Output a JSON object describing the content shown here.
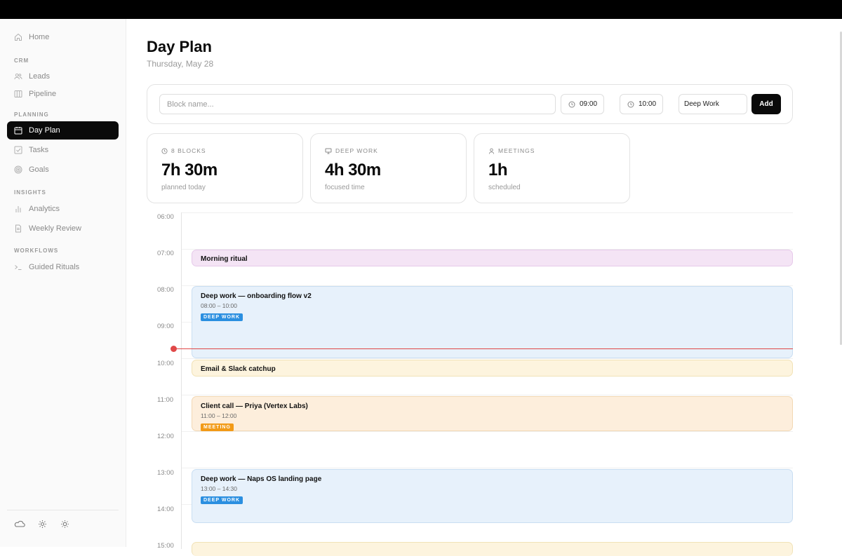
{
  "sidebar": {
    "home": "Home",
    "sections": {
      "crm": "CRM",
      "planning": "PLANNING",
      "insights": "INSIGHTS",
      "workflows": "WORKFLOWS"
    },
    "items": {
      "leads": "Leads",
      "pipeline": "Pipeline",
      "day_plan": "Day Plan",
      "tasks": "Tasks",
      "goals": "Goals",
      "analytics": "Analytics",
      "weekly_review": "Weekly Review",
      "guided_rituals": "Guided Rituals"
    },
    "active_item": "Day Plan",
    "footer_icons": [
      "cloud-icon",
      "settings-gear-icon",
      "sun-icon"
    ]
  },
  "header": {
    "title": "Day Plan",
    "date": "Thursday, May 28"
  },
  "add_bar": {
    "name_placeholder": "Block name...",
    "start_time": "09:00",
    "end_time": "10:00",
    "category": "Deep Work",
    "add_label": "Add"
  },
  "stats": [
    {
      "label": "8 BLOCKS",
      "value": "7h 30m",
      "sub": "planned today",
      "icon": "clock-icon"
    },
    {
      "label": "DEEP WORK",
      "value": "4h 30m",
      "sub": "focused time",
      "icon": "monitor-icon"
    },
    {
      "label": "MEETINGS",
      "value": "1h",
      "sub": "scheduled",
      "icon": "person-icon"
    }
  ],
  "timeline": {
    "hours": [
      "06:00",
      "07:00",
      "08:00",
      "09:00",
      "10:00",
      "11:00",
      "12:00",
      "13:00",
      "14:00",
      "15:00"
    ],
    "current_time_marker": "09:45",
    "blocks": [
      {
        "title": "Morning ritual",
        "time": "",
        "tag": "",
        "color": "#f3e3f5"
      },
      {
        "title": "Deep work — onboarding flow v2",
        "time": "08:00 – 10:00",
        "tag": "DEEP WORK",
        "color": "#e6f1fb"
      },
      {
        "title": "Email & Slack catchup",
        "time": "",
        "tag": "",
        "color": "#fdf4dd"
      },
      {
        "title": "Client call — Priya (Vertex Labs)",
        "time": "11:00 – 12:00",
        "tag": "MEETING",
        "color": "#fdeedb"
      },
      {
        "title": "Deep work — Naps OS landing page",
        "time": "13:00 – 14:30",
        "tag": "DEEP WORK",
        "color": "#e6f1fb"
      }
    ],
    "tag_colors": {
      "deep_work": "#2b8fe0",
      "meeting": "#f29a17"
    },
    "now_color": "#e04848"
  }
}
